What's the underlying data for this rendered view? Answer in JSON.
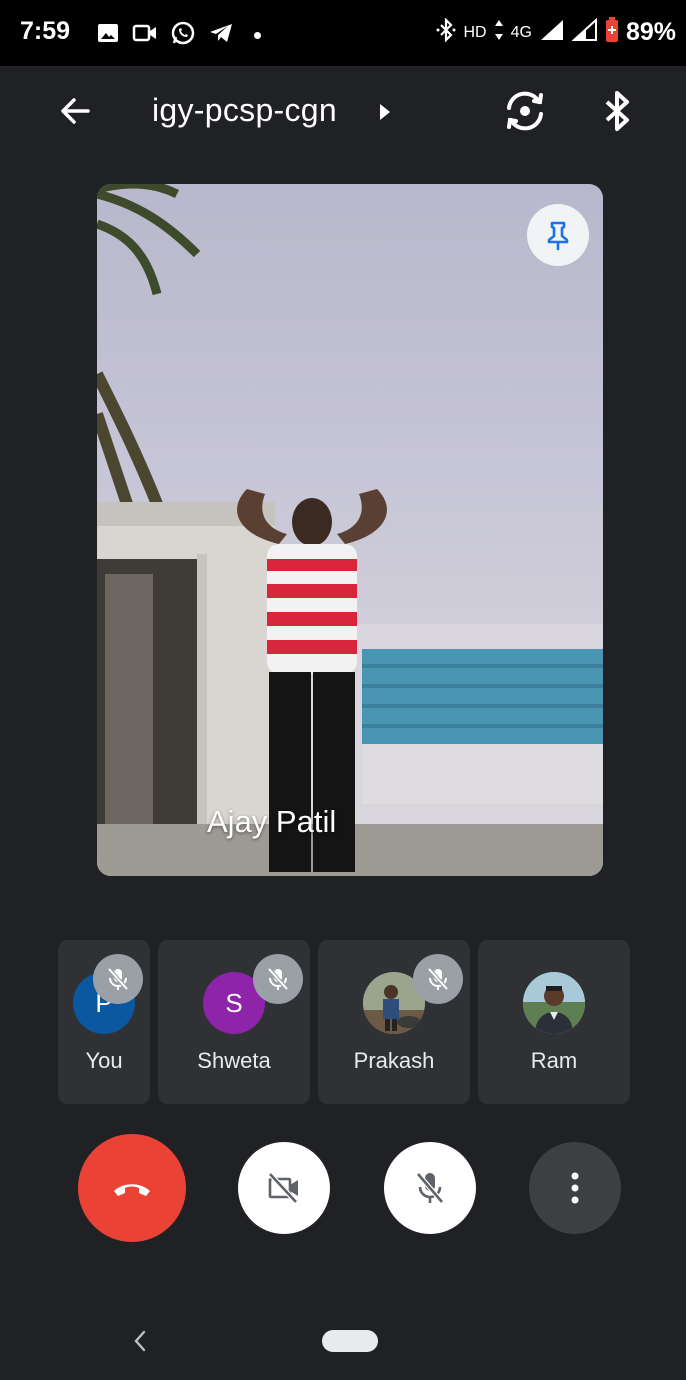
{
  "status_bar": {
    "time": "7:59",
    "left_icons": [
      "image-icon",
      "video-icon",
      "whatsapp-icon",
      "telegram-icon"
    ],
    "hd_label": "HD",
    "network_label": "4G",
    "battery_percent": "89%"
  },
  "top_bar": {
    "meeting_code": "igy-pcsp-cgn"
  },
  "main_video": {
    "speaker_name": "Ajay Patil"
  },
  "participants": [
    {
      "name": "You",
      "initial": "P",
      "avatar_color": "#0b57a0",
      "muted": true
    },
    {
      "name": "Shweta",
      "initial": "S",
      "avatar_color": "#8e24aa",
      "muted": true
    },
    {
      "name": "Prakash",
      "initial": "",
      "avatar_color": "#7a8a6a",
      "muted": true
    },
    {
      "name": "Ram",
      "initial": "",
      "avatar_color": "#8ab4c8",
      "muted": false
    }
  ],
  "controls": {
    "end_call_color": "#ea4335",
    "more_color": "#3c4043"
  },
  "colors": {
    "background": "#202124",
    "tile": "#303134",
    "pin_icon": "#1a73e8",
    "mute_badge": "#9aa0a6"
  }
}
